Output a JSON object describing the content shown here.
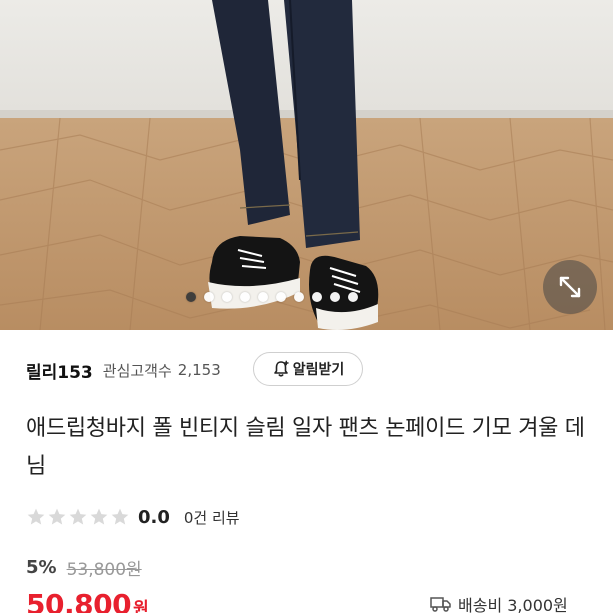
{
  "carousel": {
    "slide_count": 10,
    "active_index": 0
  },
  "icons": {
    "expand": "expand-arrows-icon",
    "bell": "bell-plus-icon",
    "star": "star-icon",
    "truck": "delivery-truck-icon"
  },
  "seller": {
    "name": "릴리153",
    "follower_label": "관심고객수",
    "follower_count": "2,153",
    "alert_button_label": "알림받기"
  },
  "product": {
    "title": "애드립청바지 폴 빈티지 슬림 일자 팬츠 논페이드 기모 겨울 데님"
  },
  "rating": {
    "stars_filled": 0,
    "stars_total": 5,
    "value": "0.0",
    "review_text": "0건 리뷰"
  },
  "price": {
    "discount": "5%",
    "original": "53,800원",
    "sale": "50,800",
    "sale_unit": "원"
  },
  "shipping": {
    "text": "배송비 3,000원"
  },
  "colors": {
    "sale_red": "#e8202e",
    "star_gray": "#d9d9d9",
    "active_dot": "#3a3a3a"
  }
}
